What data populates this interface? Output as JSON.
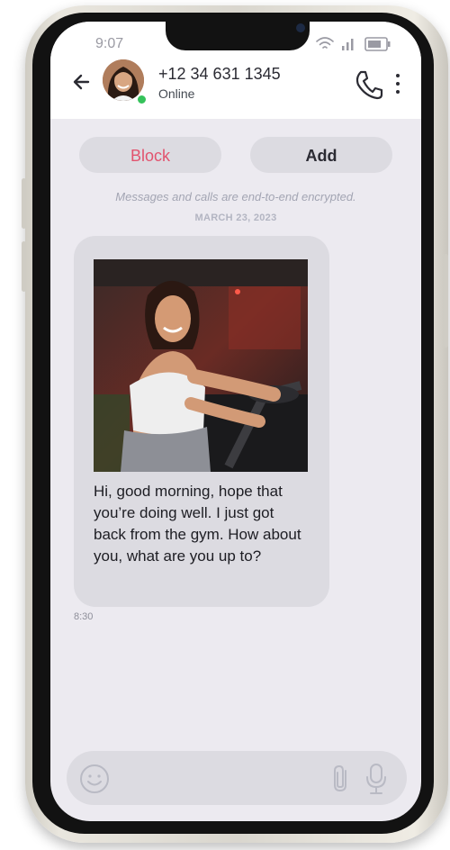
{
  "status_bar": {
    "time": "9:07"
  },
  "header": {
    "phone_number": "+12 34 631 1345",
    "presence": "Online"
  },
  "actions": {
    "block_label": "Block",
    "add_label": "Add"
  },
  "chat": {
    "encryption_notice": "Messages and calls are end-to-end encrypted.",
    "date_label": "MARCH 23, 2023",
    "messages": [
      {
        "text": "Hi, good morning, hope that you’re doing well. I just got back from the gym. How about you, what are you up to?",
        "time": "8:30"
      }
    ]
  },
  "icons": {
    "back": "arrow-left-icon",
    "call": "phone-icon",
    "more": "more-vertical-icon",
    "emoji": "emoji-icon",
    "attach": "paperclip-icon",
    "mic": "microphone-icon",
    "wifi": "wifi-icon",
    "signal": "signal-icon",
    "battery": "battery-icon"
  },
  "colors": {
    "block_text": "#e2536e",
    "bubble_bg": "#dcdbe1",
    "screen_bg": "#eceaf0",
    "online_dot": "#35c25a"
  }
}
